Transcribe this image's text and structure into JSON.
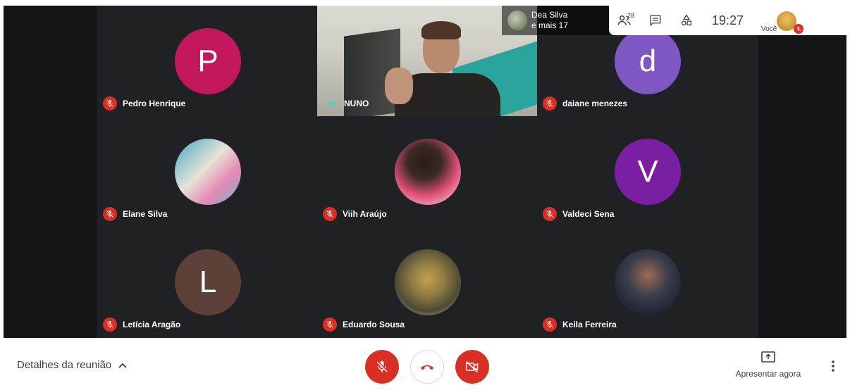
{
  "participants": [
    {
      "name": "Pedro Henrique",
      "initial": "P",
      "color": "#c2185b",
      "muted": true
    },
    {
      "name": "daiane menezes",
      "initial": "d",
      "color": "#7e57c2",
      "muted": true
    },
    {
      "name": "Elane Silva",
      "initial": "",
      "color": "#3fa9c9",
      "muted": true,
      "photo": true
    },
    {
      "name": "Viih Araújo",
      "initial": "",
      "color": "#e0507a",
      "muted": true,
      "photo": true
    },
    {
      "name": "Valdeci Sena",
      "initial": "V",
      "color": "#7b1fa2",
      "muted": true
    },
    {
      "name": "Letícia Aragão",
      "initial": "L",
      "color": "#5d4037",
      "muted": true
    },
    {
      "name": "Eduardo Sousa",
      "initial": "",
      "color": "#8c7a45",
      "muted": true,
      "photo": true
    },
    {
      "name": "Keila Ferreira",
      "initial": "",
      "color": "#3a3e4a",
      "muted": true,
      "photo": true
    }
  ],
  "active_speaker": {
    "name": "NUNO"
  },
  "topbar": {
    "who_line1": "Dea Silva",
    "who_line2": "e mais 17",
    "people_count": "28",
    "time": "19:27",
    "you_label": "Você"
  },
  "bottombar": {
    "details_label": "Detalhes da reunião",
    "present_label": "Apresentar agora"
  },
  "colors": {
    "mute_red": "#d93025",
    "grid_bg": "#202124",
    "speaking": "#1de9b6"
  }
}
